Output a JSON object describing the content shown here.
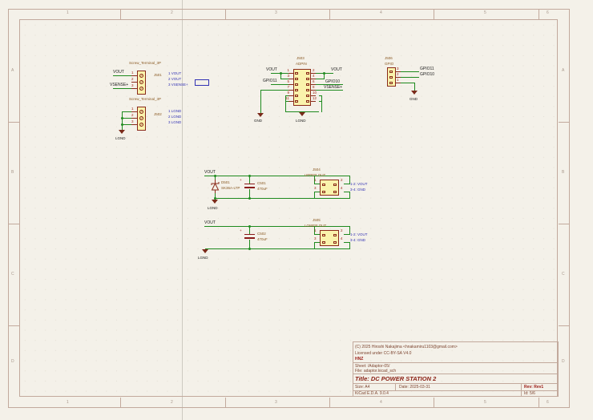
{
  "zones": {
    "cols": [
      "1",
      "2",
      "3",
      "4",
      "5",
      "6"
    ],
    "rows": [
      "A",
      "B",
      "C",
      "D"
    ]
  },
  "colors": {
    "background": "#f4f1e9",
    "wire_green": "#1e8a1e",
    "symbol_red": "#8a2a1a",
    "symbol_fill": "#faf3ac",
    "note_blue": "#3232b4",
    "pin_number_red": "#a02818",
    "component_text": "#8a5a24",
    "frame": "#c2a99c",
    "titleblock_text": "#7d4530",
    "titleblock_accent": "#9a1a14"
  },
  "j501": {
    "value": "Screw_Terminal_3P",
    "ref": "J501",
    "label_vout": "VOUT",
    "label_vsense": "VSENSE+",
    "pins": [
      "1",
      "2",
      "3"
    ],
    "notes": [
      "1 VOUT",
      "2 VOUT",
      "3 VSENSE+"
    ]
  },
  "j502": {
    "value": "Screw_Terminal_3P",
    "ref": "J502",
    "pins": [
      "1",
      "2",
      "3"
    ],
    "notes": [
      "1 LGND",
      "2 LGND",
      "3 LGND"
    ],
    "gnd": "LGND"
  },
  "j503": {
    "ref": "J503",
    "value": "ADPIN",
    "left_pins": [
      "1",
      "3",
      "5",
      "7",
      "9",
      "11"
    ],
    "right_pins": [
      "2",
      "4",
      "6",
      "8",
      "10",
      "12"
    ],
    "label_vout_left": "VOUT",
    "label_gpio11": "GPIO11",
    "label_vout_right": "VOUT",
    "label_gpio10": "GPIO10",
    "label_vsense": "VSENSE+",
    "gnd": "GND",
    "lgnd": "LGND"
  },
  "j506": {
    "ref": "J506",
    "value": "GPIO",
    "pins": [
      "3",
      "2",
      "1"
    ],
    "label_gpio11": "GPIO11",
    "label_gpio10": "GPIO10",
    "gnd": "GND"
  },
  "j504": {
    "ref": "J504",
    "value": "UPPER OUT",
    "label_vout": "VOUT",
    "diode_ref": "D501",
    "diode_value": "SK36A-LTP",
    "cap_ref": "C501",
    "cap_value": "470uF",
    "plus": "+",
    "pins": [
      "1",
      "2",
      "3",
      "4"
    ],
    "notes": [
      "1-2: VOUT",
      "3-4: GND"
    ],
    "gnd": "LGND"
  },
  "j505": {
    "ref": "J505",
    "value": "LOWER OUT",
    "label_vout": "VOUT",
    "cap_ref": "C502",
    "cap_value": "470uF",
    "plus": "+",
    "pins": [
      "1",
      "2",
      "3",
      "4"
    ],
    "notes": [
      "1-2: VOUT",
      "3-4: GND"
    ],
    "gnd": "LGND"
  },
  "title_block": {
    "comment_copyright": "(C) 2025 Hiroshi Nakajima <hnakamiru1103@gmail.com>",
    "comment_license": "Licensed under CC-BY-SA V4.0",
    "comment_company": "HNZ",
    "sheet_path": "Sheet: /Adaptor-05/",
    "file": "File: adaptor.kicad_sch",
    "title": "Title: DC POWER STATION 2",
    "size": "Size: A4",
    "date": "Date: 2025-03-31",
    "rev": "Rev: Rev1",
    "tool": "KiCad E.D.A. 9.0.4",
    "id": "Id: 5/6"
  }
}
